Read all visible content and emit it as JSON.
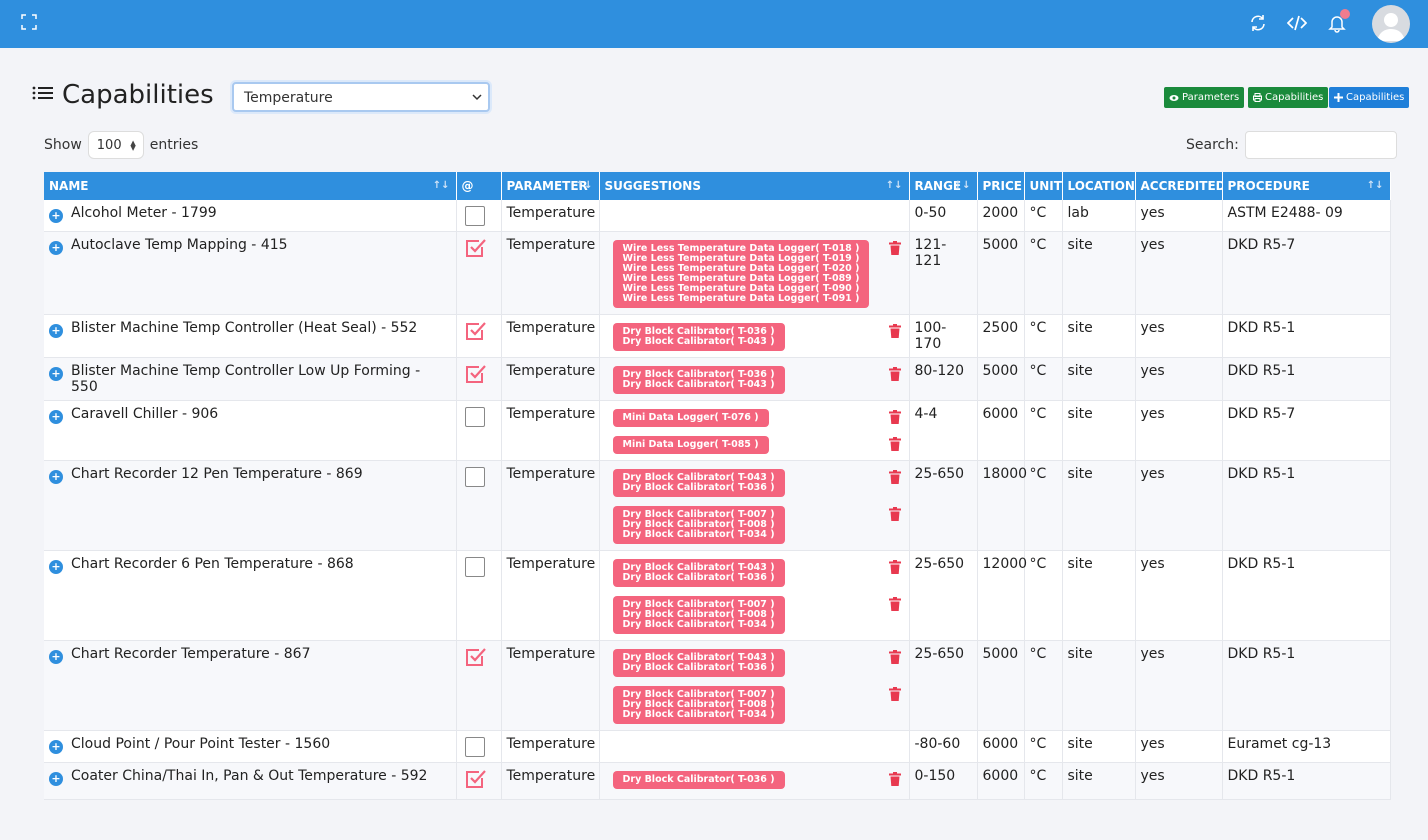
{
  "header": {
    "icons": [
      "expand-icon",
      "refresh-icon",
      "code-icon",
      "bell-icon",
      "avatar"
    ]
  },
  "page": {
    "title": "Capabilities",
    "category_select": "Temperature",
    "buttons": {
      "parameters": "Parameters",
      "capabilities_print": "Capabilities",
      "add_capabilities": "Capabilities"
    }
  },
  "table_controls": {
    "show_label": "Show",
    "entries_value": "100",
    "entries_label": "entries",
    "search_label": "Search:",
    "search_value": ""
  },
  "columns": [
    "NAME",
    "@",
    "PARAMETER",
    "SUGGESTIONS",
    "RANGE",
    "PRICE",
    "UNIT",
    "LOCATION",
    "ACCREDITED",
    "PROCEDURE"
  ],
  "rows": [
    {
      "name": "Alcohol Meter - 1799",
      "checked": false,
      "parameter": "Temperature",
      "suggestions": [],
      "range": "0-50",
      "price": "2000",
      "unit": "°C",
      "location": "lab",
      "accredited": "yes",
      "procedure": "ASTM E2488- 09"
    },
    {
      "name": "Autoclave Temp Mapping - 415",
      "checked": true,
      "parameter": "Temperature",
      "suggestions": [
        "Wire Less Temperature Data Logger( T-018 )\nWire Less Temperature Data Logger( T-019 )\nWire Less Temperature Data Logger( T-020 )\nWire Less Temperature Data Logger( T-089 )\nWire Less Temperature Data Logger( T-090 )\nWire Less Temperature Data Logger( T-091 )"
      ],
      "range": "121-121",
      "price": "5000",
      "unit": "°C",
      "location": "site",
      "accredited": "yes",
      "procedure": "DKD R5-7"
    },
    {
      "name": "Blister Machine Temp Controller (Heat Seal) - 552",
      "checked": true,
      "parameter": "Temperature",
      "suggestions": [
        "Dry Block Calibrator( T-036 )\nDry Block Calibrator( T-043 )"
      ],
      "range": "100-170",
      "price": "2500",
      "unit": "°C",
      "location": "site",
      "accredited": "yes",
      "procedure": "DKD R5-1"
    },
    {
      "name": "Blister Machine Temp Controller Low Up Forming - 550",
      "checked": true,
      "parameter": "Temperature",
      "suggestions": [
        "Dry Block Calibrator( T-036 )\nDry Block Calibrator( T-043 )"
      ],
      "range": "80-120",
      "price": "5000",
      "unit": "°C",
      "location": "site",
      "accredited": "yes",
      "procedure": "DKD R5-1"
    },
    {
      "name": "Caravell Chiller - 906",
      "checked": false,
      "parameter": "Temperature",
      "suggestions": [
        "Mini Data Logger( T-076 )",
        "Mini Data Logger( T-085 )"
      ],
      "range": "4-4",
      "price": "6000",
      "unit": "°C",
      "location": "site",
      "accredited": "yes",
      "procedure": "DKD R5-7"
    },
    {
      "name": "Chart Recorder 12 Pen Temperature - 869",
      "checked": false,
      "parameter": "Temperature",
      "suggestions": [
        "Dry Block Calibrator( T-043 )\nDry Block Calibrator( T-036 )",
        "Dry Block Calibrator( T-007 )\nDry Block Calibrator( T-008 )\nDry Block Calibrator( T-034 )"
      ],
      "range": "25-650",
      "price": "18000",
      "unit": "°C",
      "location": "site",
      "accredited": "yes",
      "procedure": "DKD R5-1"
    },
    {
      "name": "Chart Recorder 6 Pen Temperature - 868",
      "checked": false,
      "parameter": "Temperature",
      "suggestions": [
        "Dry Block Calibrator( T-043 )\nDry Block Calibrator( T-036 )",
        "Dry Block Calibrator( T-007 )\nDry Block Calibrator( T-008 )\nDry Block Calibrator( T-034 )"
      ],
      "range": "25-650",
      "price": "12000",
      "unit": "°C",
      "location": "site",
      "accredited": "yes",
      "procedure": "DKD R5-1"
    },
    {
      "name": "Chart Recorder Temperature - 867",
      "checked": true,
      "parameter": "Temperature",
      "suggestions": [
        "Dry Block Calibrator( T-043 )\nDry Block Calibrator( T-036 )",
        "Dry Block Calibrator( T-007 )\nDry Block Calibrator( T-008 )\nDry Block Calibrator( T-034 )"
      ],
      "range": "25-650",
      "price": "5000",
      "unit": "°C",
      "location": "site",
      "accredited": "yes",
      "procedure": "DKD R5-1"
    },
    {
      "name": "Cloud Point / Pour Point Tester - 1560",
      "checked": false,
      "parameter": "Temperature",
      "suggestions": [],
      "range": "-80-60",
      "price": "6000",
      "unit": "°C",
      "location": "site",
      "accredited": "yes",
      "procedure": "Euramet cg-13"
    },
    {
      "name": "Coater China/Thai In, Pan & Out Temperature - 592",
      "checked": true,
      "parameter": "Temperature",
      "suggestions": [
        "Dry Block Calibrator( T-036 )"
      ],
      "range": "0-150",
      "price": "6000",
      "unit": "°C",
      "location": "site",
      "accredited": "yes",
      "procedure": "DKD R5-1"
    }
  ],
  "colors": {
    "header": "#2f8fde",
    "tag": "#f4647e",
    "check": "#f4647e",
    "green_button": "#1a8a3c",
    "blue_button": "#1f7fd9"
  }
}
